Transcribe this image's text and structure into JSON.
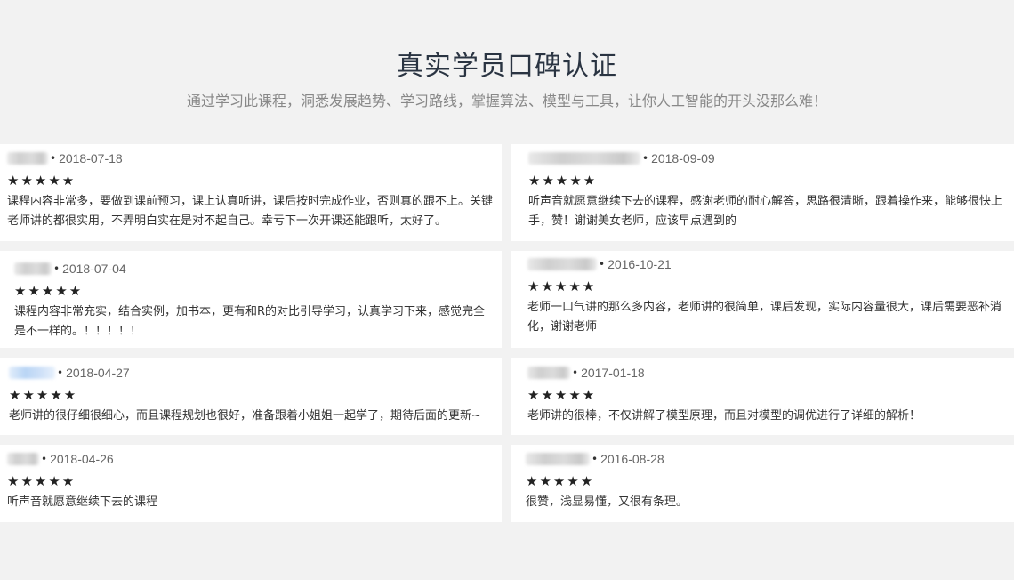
{
  "header": {
    "title": "真实学员口碑认证",
    "subtitle": "通过学习此课程，洞悉发展趋势、学习路线，掌握算法、模型与工具，让你人工智能的开头没那么难！"
  },
  "reviews": [
    {
      "date": "2018-07-18",
      "stars": "★★★★★",
      "text": "课程内容非常多，要做到课前预习，课上认真听讲，课后按时完成作业，否则真的跟不上。关键老师讲的都很实用，不弄明白实在是对不起自己。幸亏下一次开课还能跟听，太好了。"
    },
    {
      "date": "2018-09-09",
      "stars": "★★★★★",
      "text": "听声音就愿意继续下去的课程，感谢老师的耐心解答，思路很清晰，跟着操作来，能够很快上手，赞！谢谢美女老师，应该早点遇到的"
    },
    {
      "date": "2018-07-04",
      "stars": "★★★★★",
      "text": "课程内容非常充实，结合实例，加书本，更有和R的对比引导学习，认真学习下来，感觉完全是不一样的。！！！！！"
    },
    {
      "date": "2016-10-21",
      "stars": "★★★★★",
      "text": "老师一口气讲的那么多内容，老师讲的很简单，课后发现，实际内容量很大，课后需要恶补消化，谢谢老师"
    },
    {
      "date": "2018-04-27",
      "stars": "★★★★★",
      "text": "老师讲的很仔细很细心，而且课程规划也很好，准备跟着小姐姐一起学了，期待后面的更新~"
    },
    {
      "date": "2017-01-18",
      "stars": "★★★★★",
      "text": "老师讲的很棒，不仅讲解了模型原理，而且对模型的调优进行了详细的解析！"
    },
    {
      "date": "2018-04-26",
      "stars": "★★★★★",
      "text": "听声音就愿意继续下去的课程"
    },
    {
      "date": "2016-08-28",
      "stars": "★★★★★",
      "text": "很赞，浅显易懂，又很有条理。"
    }
  ],
  "separator": "•"
}
